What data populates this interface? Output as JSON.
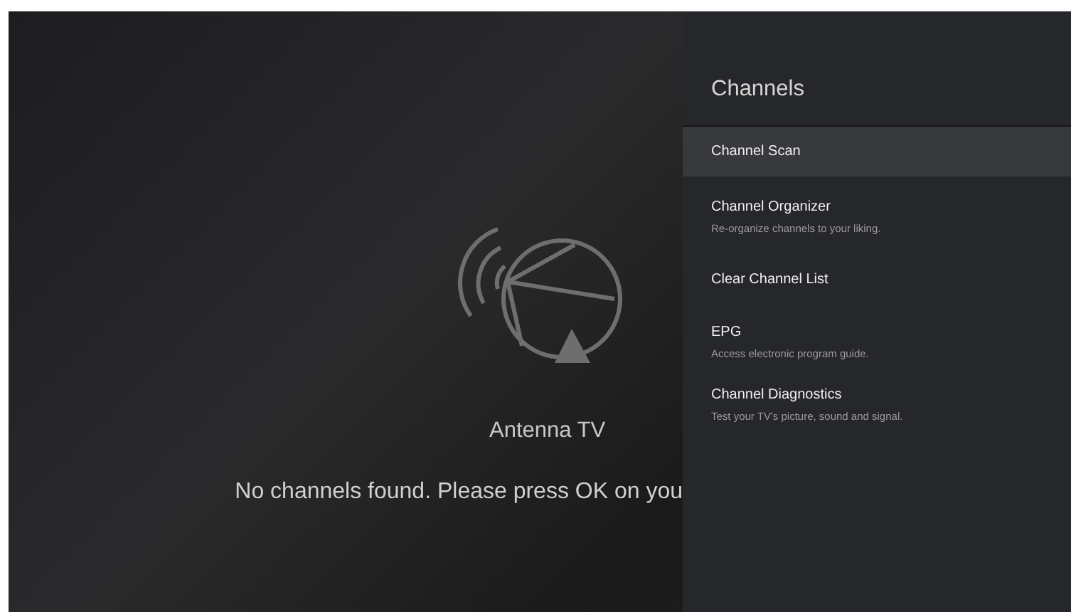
{
  "main": {
    "title": "Antenna TV",
    "message": "No channels found. Please press OK on you"
  },
  "panel": {
    "title": "Channels",
    "items": [
      {
        "label": "Channel Scan",
        "selected": true
      },
      {
        "label": "Channel Organizer",
        "description": "Re-organize channels to your liking.",
        "selected": false
      },
      {
        "label": "Clear Channel List",
        "selected": false
      },
      {
        "label": "EPG",
        "description": "Access electronic program guide.",
        "selected": false
      },
      {
        "label": "Channel Diagnostics",
        "description": "Test your TV's picture, sound and signal.",
        "selected": false
      }
    ]
  }
}
